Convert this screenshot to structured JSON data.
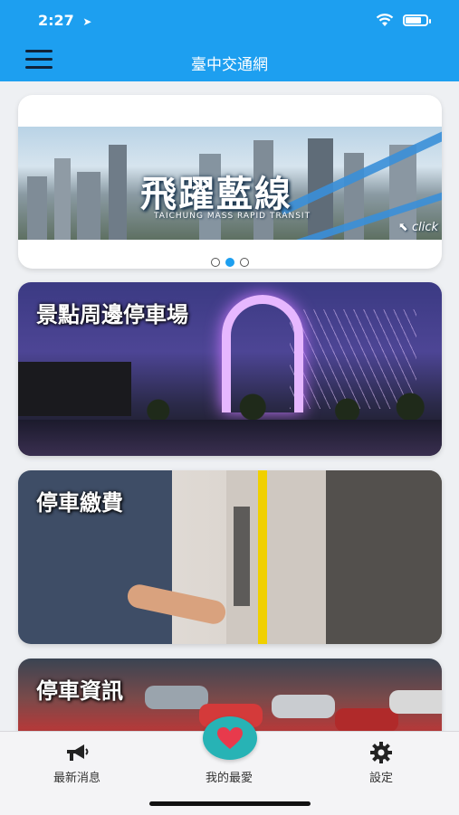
{
  "status_bar": {
    "time": "2:27"
  },
  "header": {
    "title": "臺中交通網"
  },
  "carousel": {
    "slides": [
      {
        "title": "飛躍藍線",
        "subtitle": "TAICHUNG MASS RAPID TRANSIT",
        "hint": "click"
      }
    ],
    "dot_count": 3,
    "active_index": 1
  },
  "cards": [
    {
      "label": "景點周邊停車場"
    },
    {
      "label": "停車繳費"
    },
    {
      "label": "停車資訊"
    }
  ],
  "tabbar": {
    "items": [
      {
        "label": "最新消息",
        "icon": "megaphone-icon"
      },
      {
        "label": "我的最愛",
        "icon": "heart-icon"
      },
      {
        "label": "設定",
        "icon": "gear-icon"
      }
    ]
  },
  "colors": {
    "accent": "#1d9ff0",
    "favorite_bg": "#27b3b5",
    "heart": "#e83a4c"
  }
}
